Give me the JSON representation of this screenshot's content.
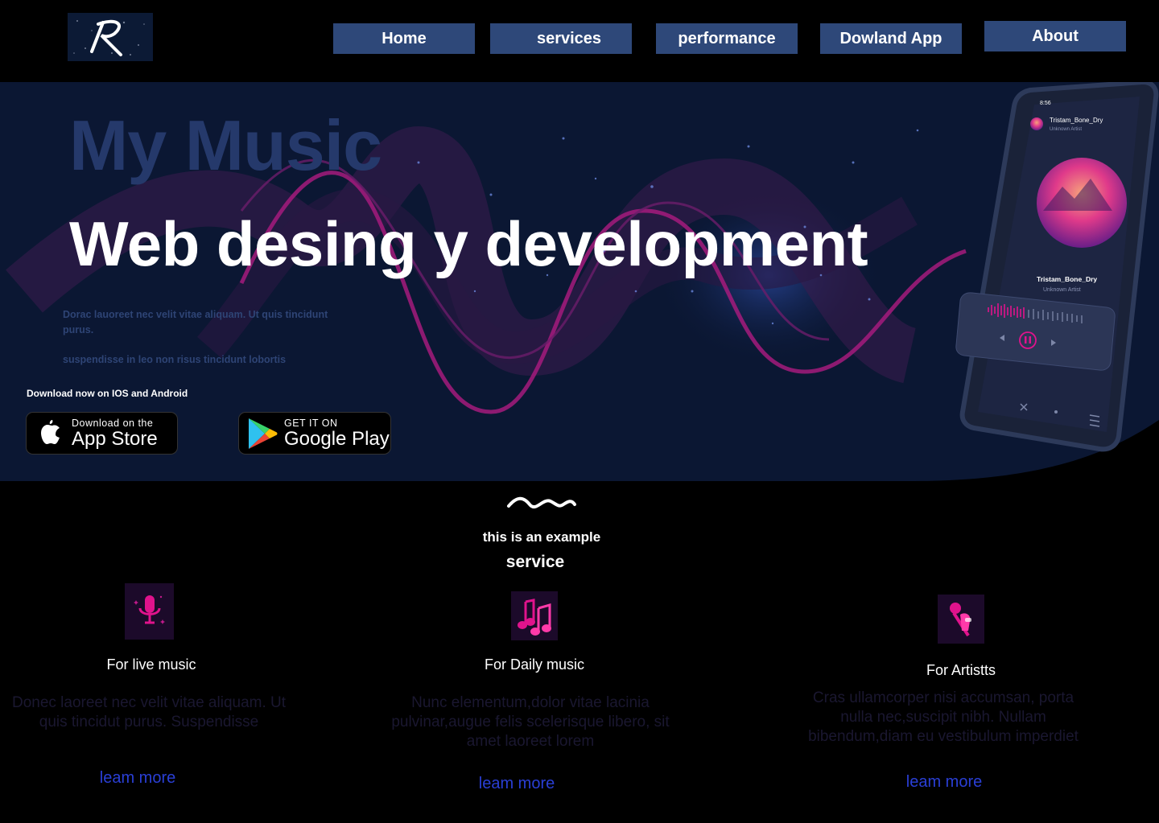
{
  "header": {
    "logo_letter": "R",
    "nav": [
      {
        "label": "Home"
      },
      {
        "label": "services"
      },
      {
        "label": "performance"
      },
      {
        "label": "Dowland App"
      },
      {
        "label": "About"
      }
    ]
  },
  "hero": {
    "title_small": "My Music",
    "title_big": "Web desing y development",
    "desc": "Dorac lauoreet nec velit vitae aliquam. Ut quis tincidunt purus.",
    "desc2": "suspendisse in leo non risus tincidunt lobortis",
    "download_label": "Download now on IOS and Android",
    "appstore": {
      "small": "Download on the",
      "big": "App Store"
    },
    "googleplay": {
      "small": "GET IT ON",
      "big": "Google Play"
    },
    "phone": {
      "time": "8:56",
      "track_header": "Tristam_Bone_Dry",
      "artist_header": "Unknown Artist",
      "track": "Tristam_Bone_Dry",
      "artist": "Unknown Artist"
    }
  },
  "section": {
    "example_label": "this is an example",
    "service_label": "service"
  },
  "services": [
    {
      "title": "For live music",
      "desc": "Donec laoreet nec velit vitae aliquam. Ut quis tincidut purus. Suspendisse",
      "link": "leam more",
      "icon": "microphone-icon"
    },
    {
      "title": "For Daily music",
      "desc": "Nunc elementum,dolor  vitae lacinia pulvinar,augue felis scelerisque libero, sit amet laoreet lorem",
      "link": "leam more",
      "icon": "music-notes-icon"
    },
    {
      "title": "For Artistts",
      "desc": "Cras ullamcorper nisi accumsan, porta nulla nec,suscipit nibh. Nullam bibendum,diam eu vestibulum imperdiet",
      "link": "leam more",
      "icon": "singer-icon"
    }
  ],
  "colors": {
    "nav_bg": "#2e4879",
    "hero_bg": "#0b1733",
    "accent_pink": "#e0138c",
    "link_blue": "#2a3fd6"
  }
}
